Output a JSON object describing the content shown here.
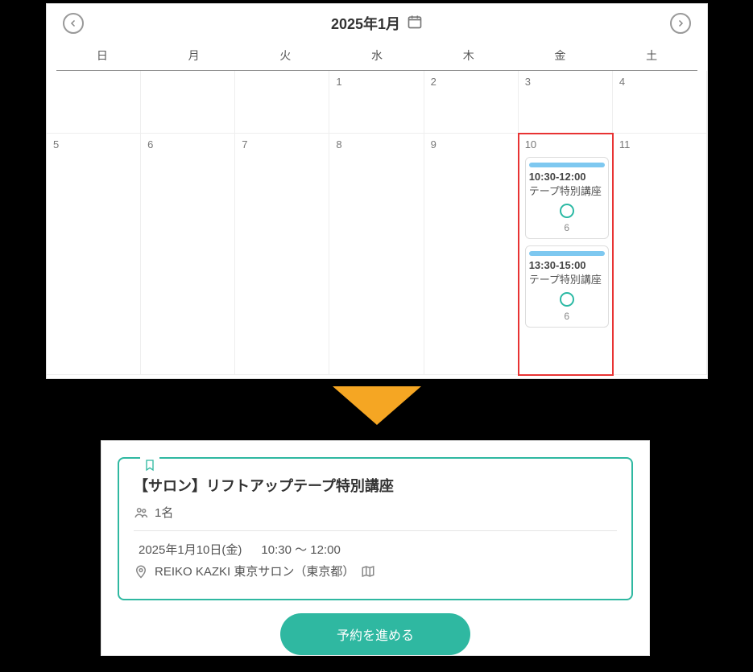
{
  "calendar": {
    "title": "2025年1月",
    "weekdays": [
      "日",
      "月",
      "火",
      "水",
      "木",
      "金",
      "土"
    ],
    "week1": [
      "",
      "",
      "",
      "1",
      "2",
      "3",
      "4"
    ],
    "week2": [
      "5",
      "6",
      "7",
      "8",
      "9",
      "10",
      "11"
    ],
    "events": [
      {
        "time": "10:30-12:00",
        "title": "テープ特別講座",
        "count": "6"
      },
      {
        "time": "13:30-15:00",
        "title": "テープ特別講座",
        "count": "6"
      }
    ]
  },
  "booking": {
    "title": "【サロン】リフトアップテープ特別講座",
    "people": "1名",
    "date": "2025年1月10日(金)",
    "time": "10:30 ～ 12:00",
    "location": "REIKO KAZKI 東京サロン（東京都）",
    "proceed_label": "予約を進める"
  }
}
